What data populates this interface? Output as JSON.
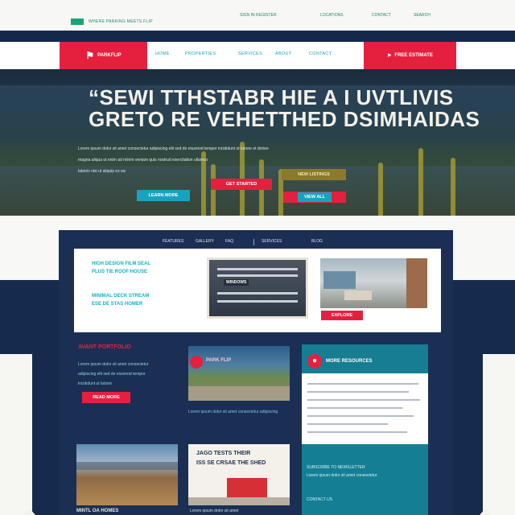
{
  "topbar": {
    "tagline": "WHERE PARKING MEETS FLIP",
    "utility": [
      "SIGN IN REGISTER",
      "LOCATIONS",
      "CONTACT",
      "SEARCH"
    ]
  },
  "nav": {
    "brand": "PARKFLIP",
    "links": [
      "HOME",
      "PROPERTIES",
      "SERVICES",
      "ABOUT",
      "CONTACT"
    ],
    "cta": "FREE ESTIMATE"
  },
  "hero": {
    "headline_1": "“SEWI TTHSTABR HIE A I UVTLIVIS",
    "headline_2": "GRETO RE VEHETTHED DSIMHAIDAS",
    "sub_1": "Lorem ipsum dolor sit amet consectetur adipiscing elit sed do eiusmod tempor incididunt ut labore et dolore",
    "sub_2": "magna aliqua ut enim ad minim veniam quis nostrud exercitation ullamco",
    "sub_3": "laboris nisi ut aliquip ex ea",
    "btn_learn": "LEARN MORE",
    "btn_start": "GET STARTED",
    "btn_view": "VIEW ALL",
    "badge": "NEW LISTINGS"
  },
  "panel": {
    "tabs": [
      "FEATURES",
      "GALLERY",
      "FAQ",
      "SERVICES",
      "BLOG"
    ],
    "features": [
      "HIGH DESIGN FILM SEAL",
      "PLUS TIE ROOF HOUSE",
      "MINIMAL DECK STREAM",
      "ESE DE STAS HOMER"
    ],
    "window_label": "WINDOWS",
    "patio_button": "EXPLORE"
  },
  "lower": {
    "title": "AVANT PORTFOLIO",
    "text": [
      "Lorem ipsum dolor sit amet consectetur",
      "adipiscing elit sed do eiusmod tempor",
      "incididunt ut labore"
    ],
    "btn": "READ MORE",
    "park_title": "PARK FLIP",
    "park_caption": "Lorem ipsum dolor sit amet consectetur adipiscing"
  },
  "teal_card": {
    "title": "MORE RESOURCES",
    "foot_1": "SUBSCRIBE TO NEWSLETTER",
    "foot_2": "Lorem ipsum dolor sit amet consectetur",
    "foot_3": "CONTACT US"
  },
  "canyon": {
    "caption": "MINTL OA HOMES"
  },
  "shed": {
    "title_1": "JAGO TESTS THEIR",
    "title_2": "ISS SE CRSAE THE SHED",
    "caption": "Lorem ipsum dolor sit amet"
  }
}
